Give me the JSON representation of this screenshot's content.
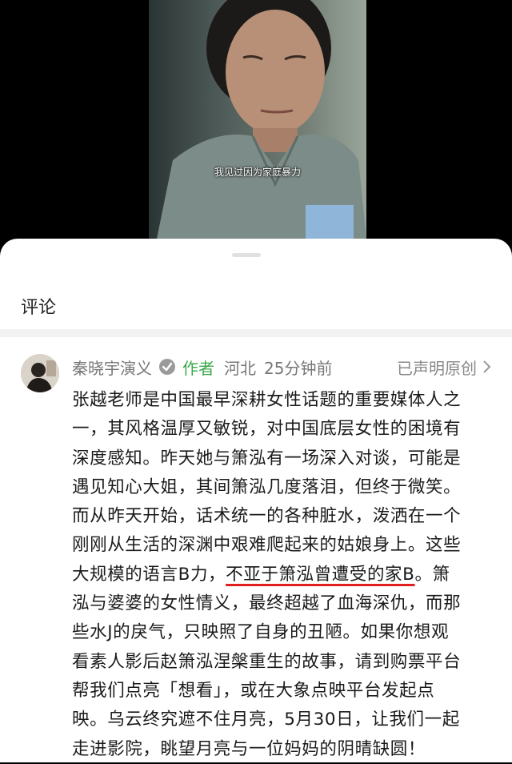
{
  "video": {
    "caption": "我见过因为家庭暴力"
  },
  "comments_sheet": {
    "title": "评论",
    "comment": {
      "author": "秦晓宇演义",
      "author_tag": "作者",
      "location": "河北",
      "time": "25分钟前",
      "declaration": "已声明原创",
      "lines": [
        "张越老师是中国最早深耕女性话题的重要媒体人之",
        "一，其风格温厚又敏锐，对中国底层女性的困境有",
        "深度感知。昨天她与箫泓有一场深入对谈，可能是",
        "遇见知心大姐，其间箫泓几度落泪，但终于微笑。",
        "而从昨天开始，话术统一的各种脏水，泼洒在一个",
        "刚刚从生活的深渊中艰难爬起来的姑娘身上。这些"
      ],
      "line7_before": "大规模的语言B力，",
      "line7_underlined": "不亚于箫泓曾遭受的家B",
      "line7_after": "。箫",
      "lines_after": [
        "泓与婆婆的女性情义，最终超越了血海深仇，而那",
        "些水J的戾气，只映照了自身的丑陋。如果你想观",
        "看素人影后赵箫泓涅槃重生的故事，请到购票平台",
        "帮我们点亮「想看」，或在大象点映平台发起点",
        "映。乌云终究遮不住月亮，5月30日，让我们一起",
        "走进影院，眺望月亮与一位妈妈的阴晴缺圆！"
      ]
    }
  },
  "colors": {
    "author_tag": "#3aa84a",
    "underline": "#e02020",
    "meta_text": "#777777"
  }
}
